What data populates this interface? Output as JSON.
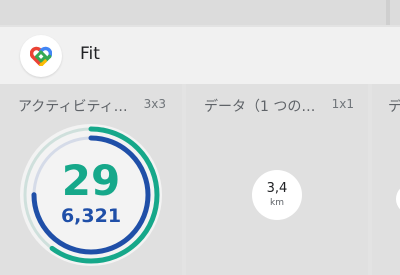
{
  "app": {
    "name": "Fit",
    "icon": "google-fit-heart-icon",
    "colors": {
      "heart_green": "#16a88a",
      "steps_blue": "#1f4fa8",
      "logo_blue": "#4285f4",
      "logo_red": "#ea4335",
      "logo_yellow": "#fbbc04",
      "logo_green": "#34a853"
    }
  },
  "widgets": [
    {
      "title": "アクティビティ…",
      "size": "3x3",
      "heart_points": "29",
      "steps": "6,321",
      "heart_progress": 0.6,
      "steps_progress": 0.75
    },
    {
      "title": "データ（1 つの…",
      "size": "1x1",
      "distance_value": "3,4",
      "distance_unit": "km"
    },
    {
      "title": "デ"
    }
  ]
}
